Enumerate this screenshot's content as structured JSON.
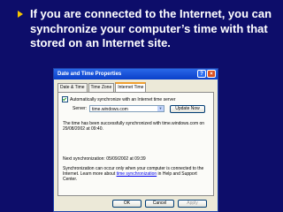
{
  "slide": {
    "bullet_text": "If you are connected to the Internet, you can synchronize your computer’s time with that stored on an Internet site."
  },
  "dialog": {
    "title": "Date and Time Properties",
    "help_glyph": "?",
    "close_glyph": "×",
    "tabs": [
      "Date & Time",
      "Time Zone",
      "Internet Time"
    ],
    "checkbox_label": "Automatically synchronize with an Internet time server",
    "server_label": "Server:",
    "server_value": "time.windows.com",
    "update_now": "Update Now",
    "status_msg": "The time has been successfully synchronized with time.windows.com on 29/08/2002 at 09:40.",
    "next_sync": "Next synchronization: 05/09/2002 at 09:39",
    "info_prefix": "Synchronization can occur only when your computer is connected to the Internet. Learn more about ",
    "info_link": "time synchronization",
    "info_suffix": " in Help and Support Center.",
    "ok": "OK",
    "cancel": "Cancel",
    "apply": "Apply"
  },
  "colors": {
    "background": "#0d0d6a",
    "bullet": "#f5c400",
    "titlebar": "#0a3fc9"
  }
}
